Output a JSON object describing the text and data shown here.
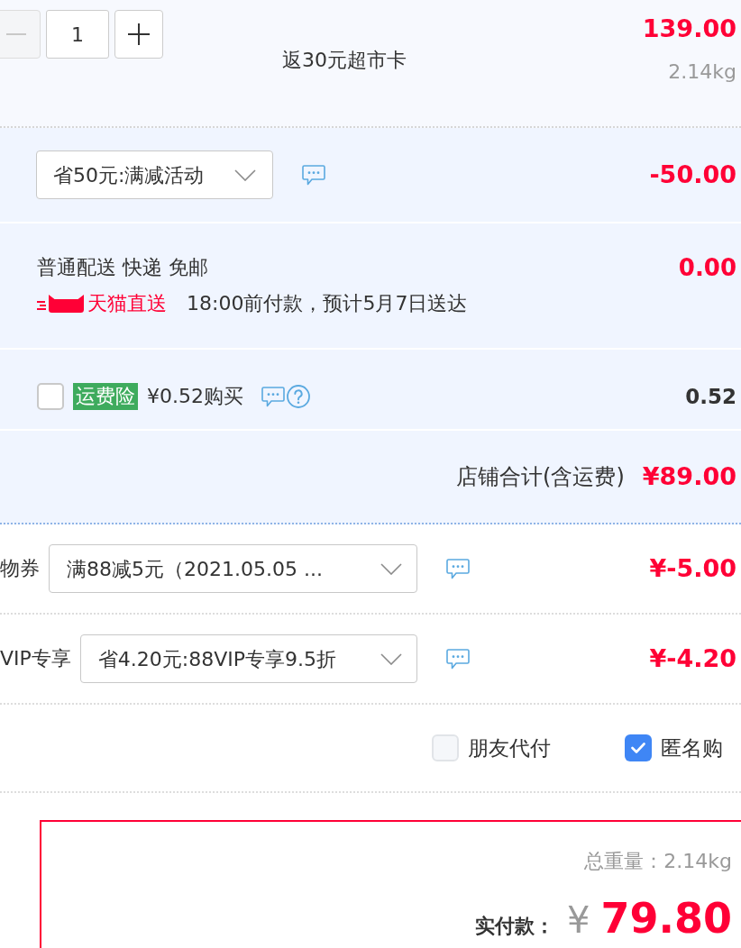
{
  "item": {
    "quantity": {
      "value": "1",
      "minus_disabled": true
    },
    "promo": "返30元超市卡",
    "price": "139.00",
    "weight": "2.14kg"
  },
  "promotion": {
    "dropdown": "省50元:满减活动",
    "amount": "-50.00"
  },
  "delivery": {
    "method": "普通配送 快递 免邮",
    "badge": "天猫直送",
    "eta": "18:00前付款，预计5月7日送达",
    "fee": "0.00"
  },
  "insurance": {
    "checked": false,
    "tag": "运费险",
    "price": "¥0.52购买",
    "amount": "0.52"
  },
  "store_total": {
    "label": "店铺合计(含运费)",
    "amount": "¥89.00"
  },
  "discounts": [
    {
      "label": "物券",
      "dropdown": "满88减5元（2021.05.05 ...",
      "amount": "¥-5.00"
    },
    {
      "label": "VIP专享",
      "dropdown": "省4.20元:88VIP专享9.5折",
      "amount": "¥-4.20"
    }
  ],
  "options": [
    {
      "label": "朋友代付",
      "checked": false
    },
    {
      "label": "匿名购",
      "checked": true
    }
  ],
  "summary": {
    "weight": "总重量：2.14kg",
    "pay_label": "实付款：",
    "currency": "¥",
    "total": "79.80"
  }
}
